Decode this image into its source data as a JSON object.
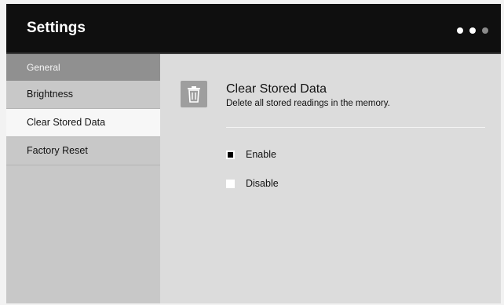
{
  "header": {
    "title": "Settings"
  },
  "sidebar": {
    "section": "General",
    "items": [
      {
        "label": "Brightness"
      },
      {
        "label": "Clear Stored Data"
      },
      {
        "label": "Factory Reset"
      }
    ]
  },
  "main": {
    "icon": "trash-icon",
    "title": "Clear Stored Data",
    "description": "Delete all stored readings in the memory.",
    "options": [
      {
        "label": "Enable",
        "checked": true
      },
      {
        "label": "Disable",
        "checked": false
      }
    ]
  },
  "colors": {
    "topbar": "#0f0f0f",
    "active_item": "#f7f7f7",
    "section": "#909090"
  }
}
